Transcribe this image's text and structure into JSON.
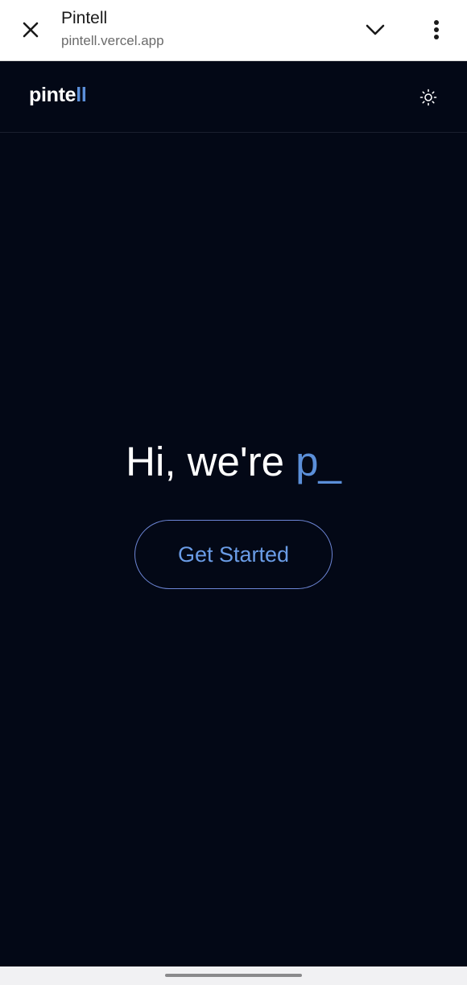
{
  "browser": {
    "title": "Pintell",
    "url": "pintell.vercel.app"
  },
  "header": {
    "logo_text": "pinte",
    "logo_accent": "ll"
  },
  "hero": {
    "heading": "Hi, we're",
    "typed_text": "p_",
    "cta_label": "Get Started"
  },
  "icons": {
    "close": "close-icon",
    "dropdown": "chevron-down-icon",
    "menu": "more-vert-icon",
    "theme": "sun-icon"
  },
  "colors": {
    "page_background": "#030816",
    "accent": "#5b8fd9",
    "cta_border": "#6d86d6",
    "browser_bar": "#ffffff"
  }
}
